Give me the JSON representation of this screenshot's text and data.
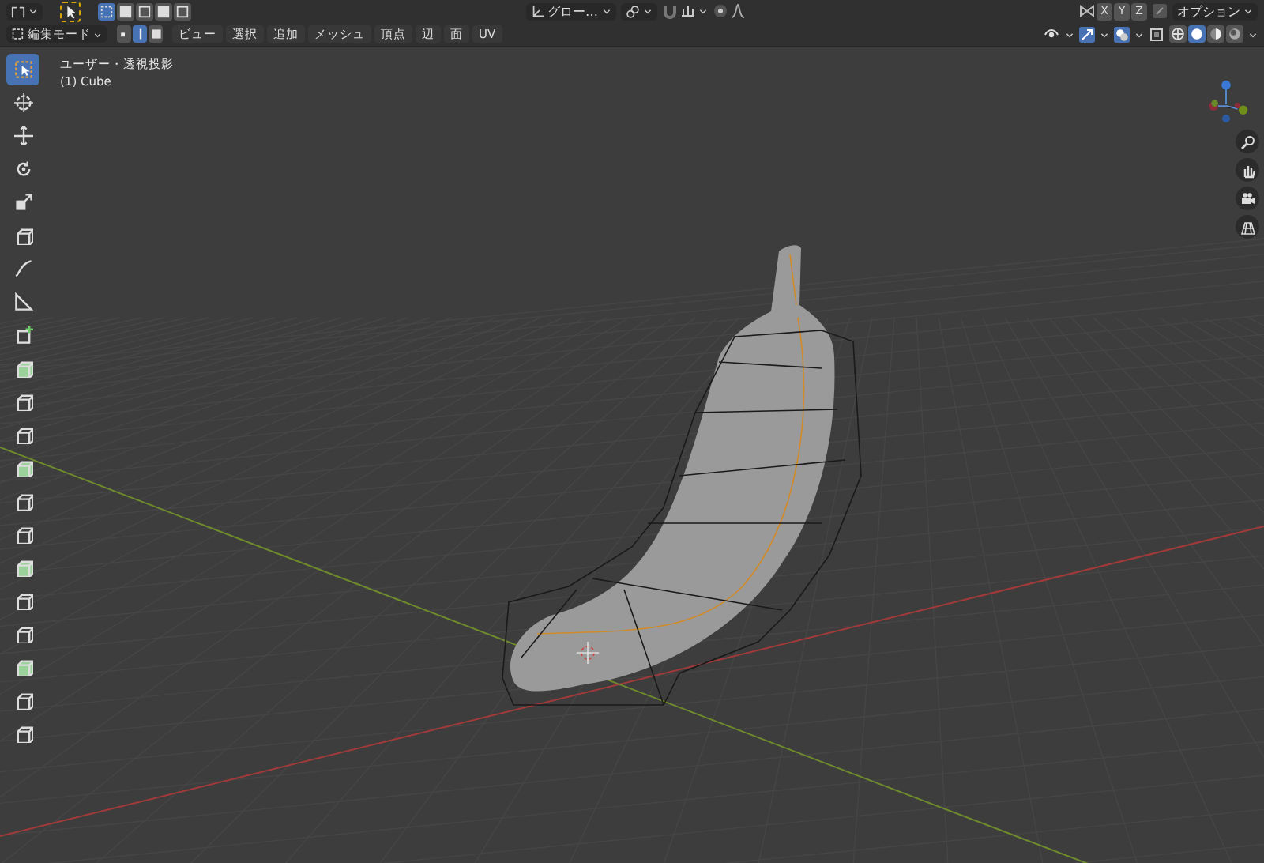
{
  "tool_settings": {
    "select_modes": [
      {
        "selected": true
      },
      {
        "selected": false
      },
      {
        "selected": false
      },
      {
        "selected": false
      },
      {
        "selected": false
      }
    ],
    "transform_orientation": "グロー…",
    "mirror_axes": [
      {
        "label": "X",
        "selected": false
      },
      {
        "label": "Y",
        "selected": false
      },
      {
        "label": "Z",
        "selected": false
      }
    ],
    "options_menu": "オプション"
  },
  "header": {
    "mode": "編集モード",
    "select_modes": [
      {
        "selected": false
      },
      {
        "selected": true
      },
      {
        "selected": false
      }
    ],
    "menus": [
      "ビュー",
      "選択",
      "追加",
      "メッシュ",
      "頂点",
      "辺",
      "面",
      "UV"
    ],
    "shading_modes": [
      {
        "selected": false
      },
      {
        "selected": true
      },
      {
        "selected": false
      },
      {
        "selected": false
      }
    ]
  },
  "viewport": {
    "view_name": "ユーザー・透視投影",
    "object_name": "(1) Cube"
  },
  "toolbar": {
    "tools": [
      {
        "selected": true
      },
      {
        "selected": false
      },
      {
        "selected": false
      },
      {
        "selected": false
      },
      {
        "selected": false
      },
      {
        "selected": false
      },
      {
        "selected": false
      },
      {
        "selected": false
      },
      {
        "selected": false
      },
      {
        "selected": false
      },
      {
        "selected": false
      },
      {
        "selected": false
      },
      {
        "selected": false
      },
      {
        "selected": false
      },
      {
        "selected": false
      },
      {
        "selected": false
      },
      {
        "selected": false
      },
      {
        "selected": false
      },
      {
        "selected": false
      },
      {
        "selected": false
      },
      {
        "selected": false
      }
    ]
  }
}
